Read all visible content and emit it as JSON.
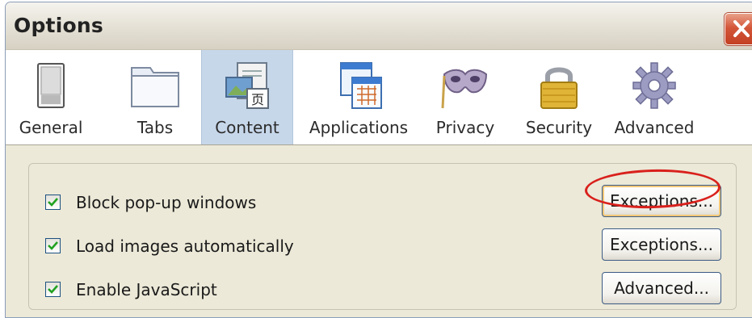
{
  "window": {
    "title": "Options"
  },
  "toolbar": {
    "items": [
      {
        "label": "General",
        "icon": "general-switch-icon"
      },
      {
        "label": "Tabs",
        "icon": "tabs-folder-icon"
      },
      {
        "label": "Content",
        "icon": "content-pictures-icon",
        "selected": true
      },
      {
        "label": "Applications",
        "icon": "applications-windows-icon"
      },
      {
        "label": "Privacy",
        "icon": "privacy-mask-icon"
      },
      {
        "label": "Security",
        "icon": "security-padlock-icon"
      },
      {
        "label": "Advanced",
        "icon": "advanced-gear-icon"
      }
    ]
  },
  "content": {
    "options": [
      {
        "label": "Block pop-up windows",
        "checked": true,
        "button": "Exceptions..."
      },
      {
        "label": "Load images automatically",
        "checked": true,
        "button": "Exceptions..."
      },
      {
        "label": "Enable JavaScript",
        "checked": true,
        "button": "Advanced..."
      }
    ]
  },
  "colors": {
    "highlight_ellipse": "#d9201c",
    "selected_tab": "#c7d7ea"
  }
}
